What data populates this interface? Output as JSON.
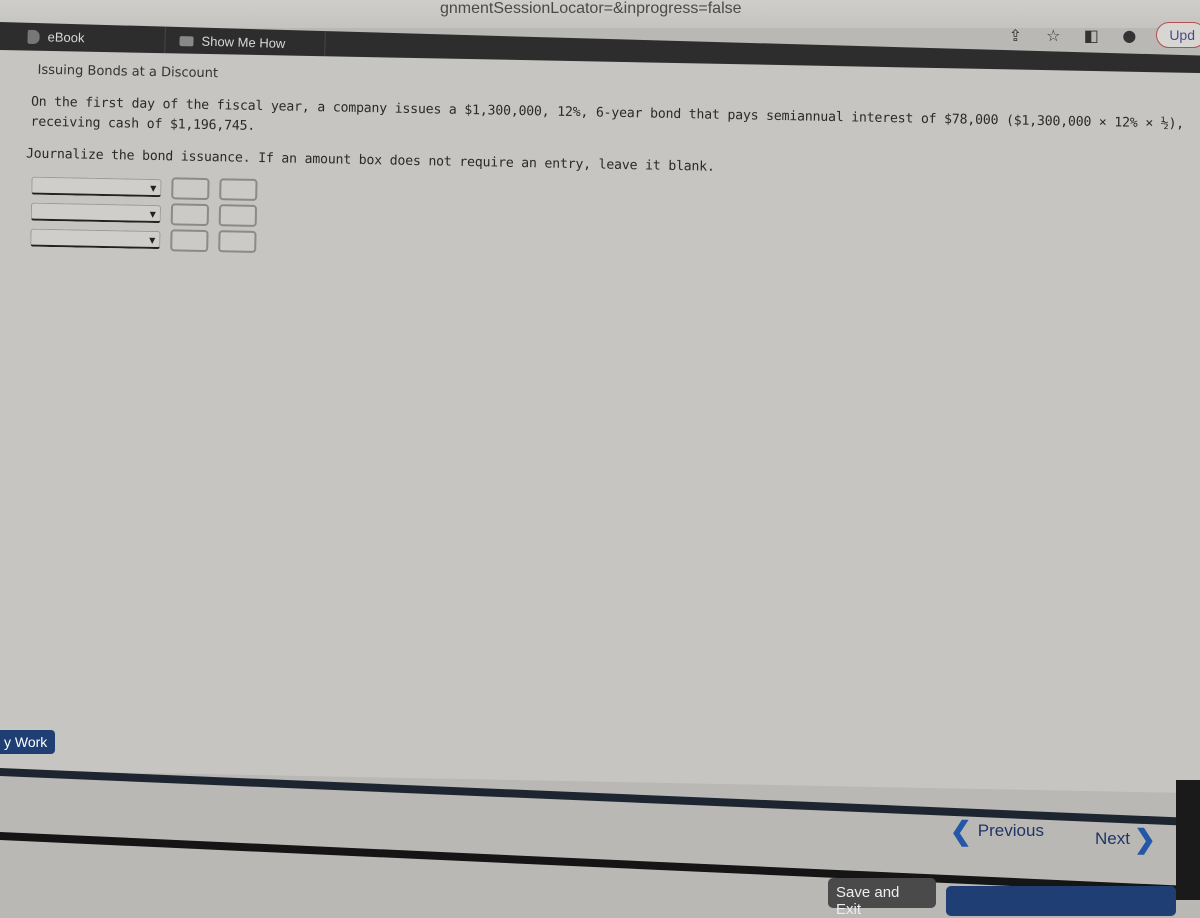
{
  "browser": {
    "url_fragment": "gnmentSessionLocator=&inprogress=false",
    "icons": [
      "share-icon",
      "star-icon",
      "sidebar-icon",
      "profile-icon"
    ],
    "update_label": "Upd"
  },
  "toolbar": {
    "items": [
      {
        "label": "eBook",
        "icon": "book-icon"
      },
      {
        "label": "Show Me How",
        "icon": "video-icon"
      }
    ]
  },
  "problem": {
    "title": "Issuing Bonds at a Discount",
    "description": "On the first day of the fiscal year, a company issues a $1,300,000, 12%, 6-year bond that pays semiannual interest of $78,000 ($1,300,000 × 12% × ½), receiving cash of $1,196,745.",
    "instruction": "Journalize the bond issuance. If an amount box does not require an entry, leave it blank."
  },
  "journal": {
    "rows": [
      {
        "account": "",
        "debit": "",
        "credit": ""
      },
      {
        "account": "",
        "debit": "",
        "credit": ""
      },
      {
        "account": "",
        "debit": "",
        "credit": ""
      }
    ]
  },
  "footer": {
    "my_work_label": "y Work",
    "previous_label": "Previous",
    "next_label": "Next",
    "save_exit_label": "Save and Exit"
  },
  "colors": {
    "accent": "#1f3f74",
    "toolbar": "#2d2d2d"
  }
}
